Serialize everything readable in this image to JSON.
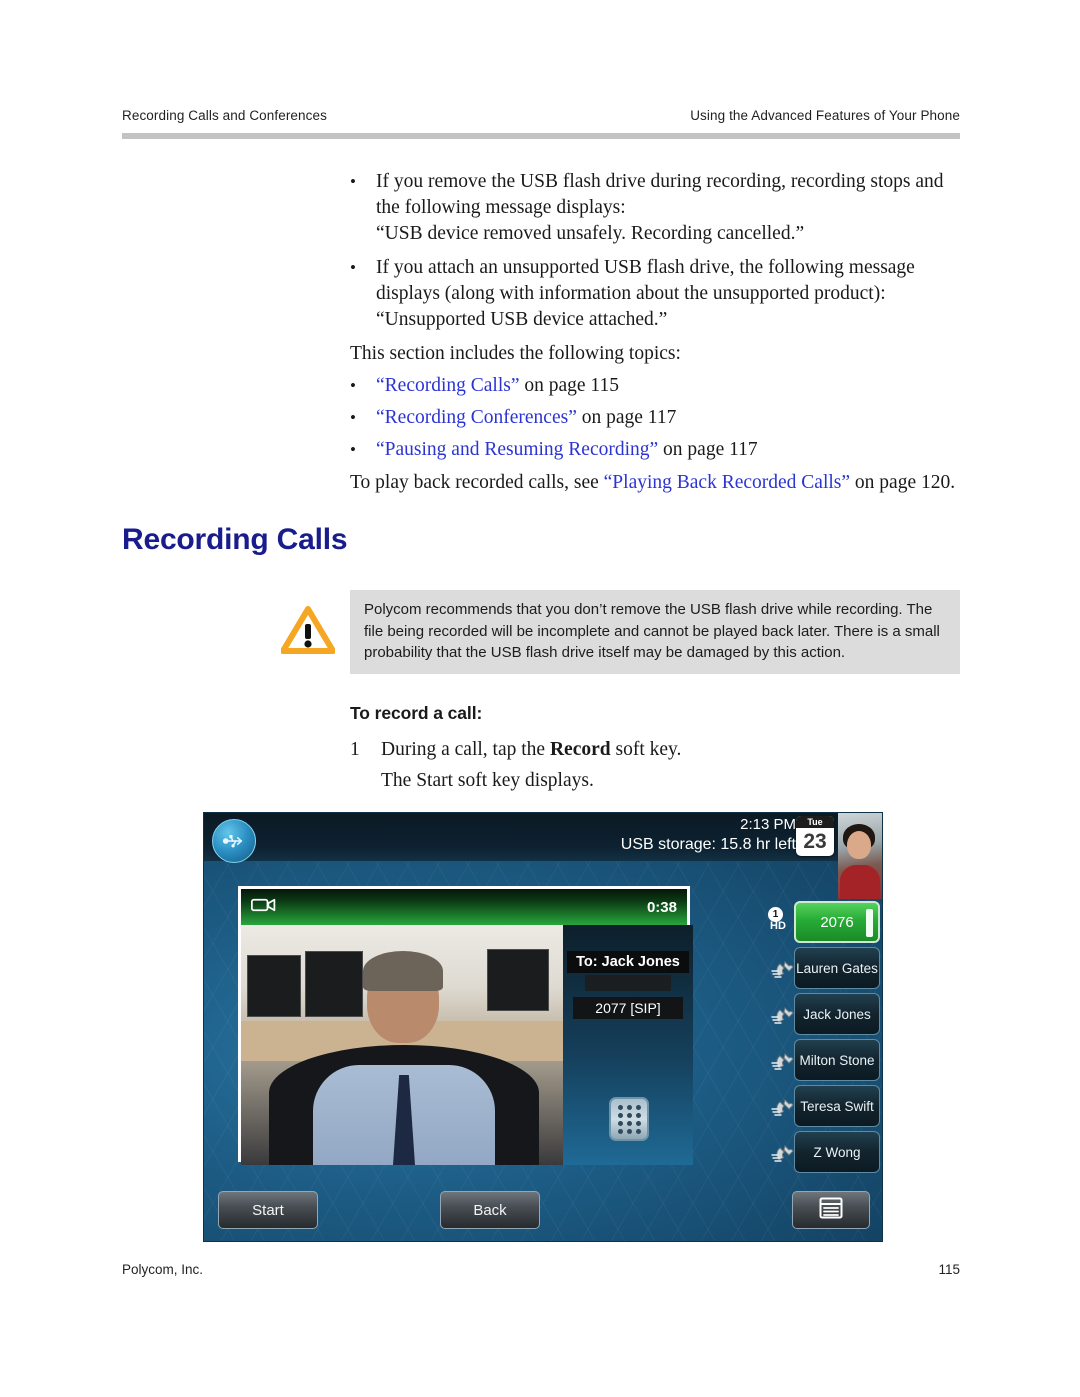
{
  "header": {
    "left": "Recording Calls and Conferences",
    "right": "Using the Advanced Features of Your Phone"
  },
  "footer": {
    "left": "Polycom, Inc.",
    "page_number": "115"
  },
  "body": {
    "bullet1": "If you remove the USB flash drive during recording, recording stops and the following message displays:",
    "quote1": "“USB device removed unsafely. Recording cancelled.”",
    "bullet2": "If you attach an unsupported USB flash drive, the following message displays (along with information about the unsupported product):",
    "quote2": "“Unsupported USB device attached.”",
    "intro": "This section includes the following topics:",
    "topics": [
      {
        "link": "“Recording Calls”",
        "tail": " on page 115"
      },
      {
        "link": "“Recording Conferences”",
        "tail": " on page 117"
      },
      {
        "link": "“Pausing and Resuming Recording”",
        "tail": " on page 117"
      }
    ],
    "playback_prefix": "To play back recorded calls, see ",
    "playback_link": "“Playing Back Recorded Calls”",
    "playback_tail": " on page 120.",
    "bullet_glyph": "•"
  },
  "section": {
    "heading": "Recording Calls"
  },
  "callout": {
    "icon": "warning-triangle-icon",
    "text": "Polycom recommends that you don’t remove the USB flash drive while recording. The file being recorded will be incomplete and cannot be played back later. There is a small probability that the USB flash drive itself may be damaged by this action."
  },
  "procedure": {
    "title": "To record a call:",
    "step_number": "1",
    "step_text_prefix": "During a call, tap the ",
    "step_text_bold": "Record",
    "step_text_suffix": " soft key.",
    "step_result": "The Start soft key displays."
  },
  "phone": {
    "status": {
      "usb_icon": "usb-icon",
      "time": "2:13 PM",
      "usb_storage": "USB storage: 15.8 hr left",
      "calendar_weekday": "Tue",
      "calendar_day": "23"
    },
    "video": {
      "record_icon": "video-camera-icon",
      "duration": "0:38"
    },
    "call_info": {
      "to_label": "To: Jack Jones",
      "sip_line": "2077 [SIP]",
      "dialpad_icon": "dialpad-icon"
    },
    "line_keys": [
      {
        "label": "2076",
        "active": true,
        "badge_number": "1",
        "badge_hd": "HD"
      },
      {
        "label": "Lauren Gates",
        "active": false
      },
      {
        "label": "Jack Jones",
        "active": false
      },
      {
        "label": "Milton Stone",
        "active": false
      },
      {
        "label": "Teresa Swift",
        "active": false
      },
      {
        "label": "Z Wong",
        "active": false
      }
    ],
    "soft_keys": {
      "start": "Start",
      "back": "Back",
      "menu_icon": "menu-list-icon"
    }
  },
  "colors": {
    "heading_blue": "#181c8c",
    "link_blue": "#2b33d4",
    "warning_amber": "#f5a623",
    "callout_bg": "#dcdcdc",
    "rule_grey": "#c3c3c3",
    "line_active_green": "#27ac36"
  }
}
